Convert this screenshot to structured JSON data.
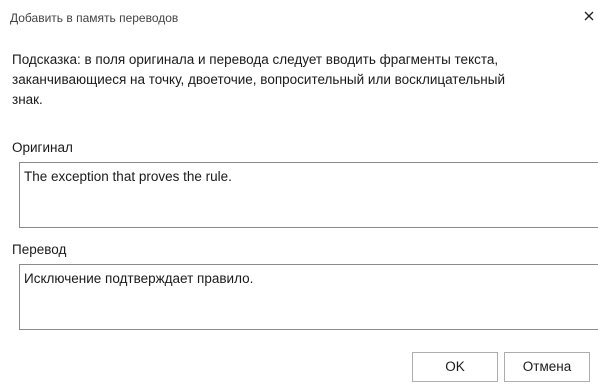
{
  "window": {
    "title": "Добавить в память переводов",
    "close_icon": "close-icon"
  },
  "hint": {
    "lines": [
      "Подсказка: в поля оригинала и перевода следует вводить  фрагменты текста,",
      "заканчивающиеся на точку, двоеточие, вопросительный или восклицательный",
      "знак."
    ]
  },
  "original": {
    "label": "Оригинал",
    "value": "The exception that proves the rule."
  },
  "translation": {
    "label": "Перевод",
    "value": "Исключение подтверждает правило."
  },
  "buttons": {
    "ok_label": "OK",
    "cancel_label": "Отмена"
  }
}
